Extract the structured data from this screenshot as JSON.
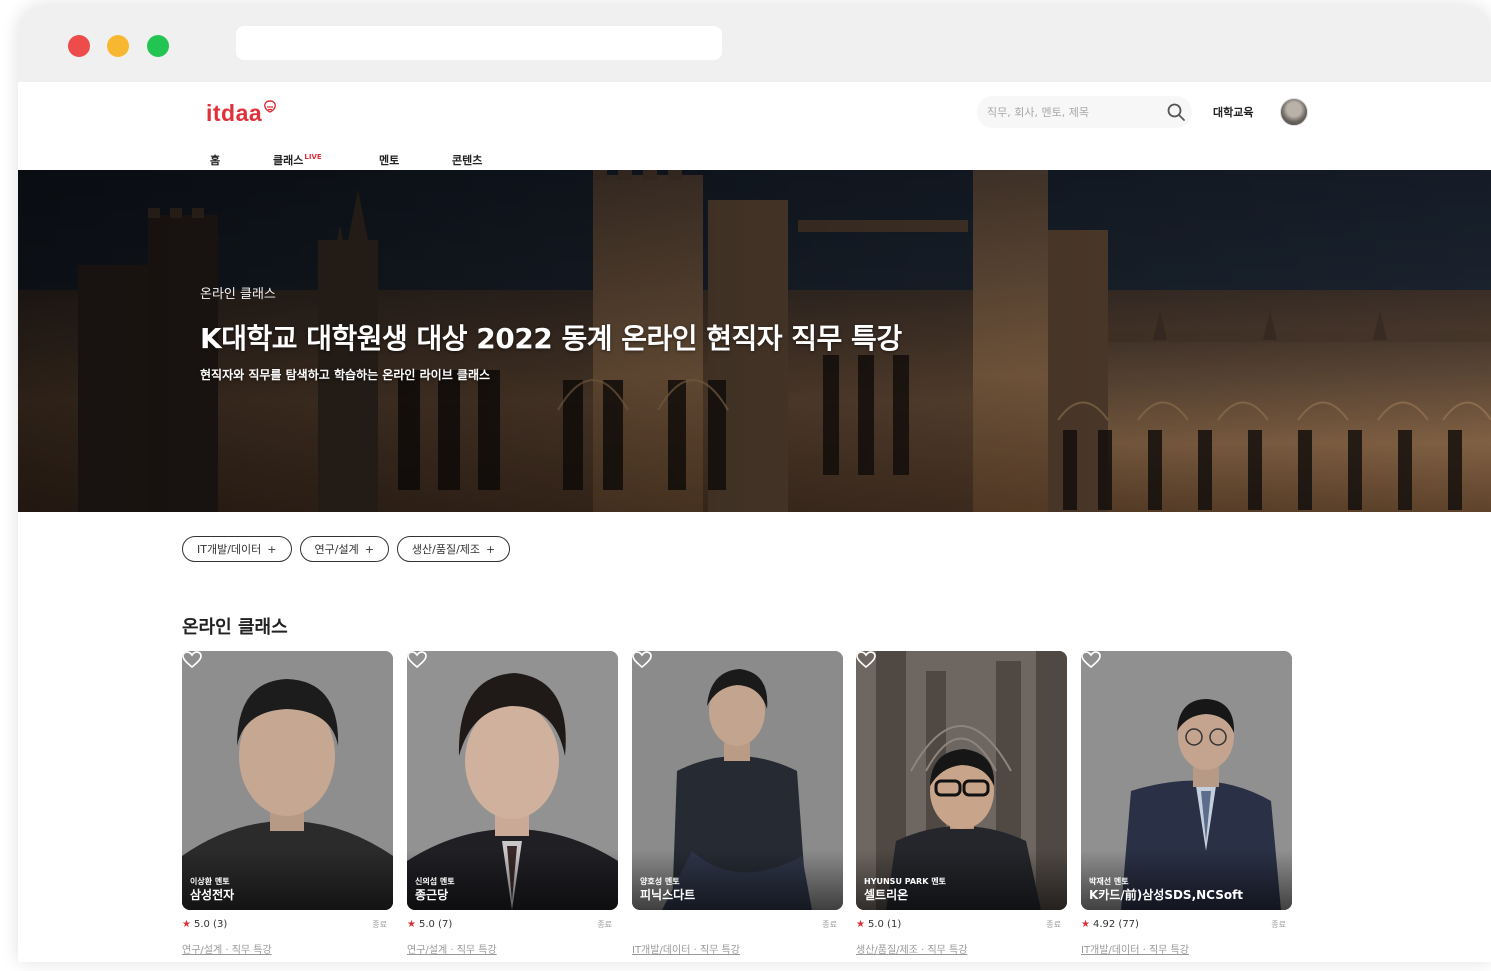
{
  "header": {
    "logo_text": "itdaa",
    "search_placeholder": "직무, 회사, 멘토, 제목",
    "university_link": "대학교육"
  },
  "nav": {
    "items": [
      {
        "label": "홈",
        "badge": ""
      },
      {
        "label": "클래스",
        "badge": "LIVE"
      },
      {
        "label": "멘토",
        "badge": ""
      },
      {
        "label": "콘텐츠",
        "badge": ""
      }
    ]
  },
  "hero": {
    "eyebrow": "온라인 클래스",
    "title": "K대학교 대학원생 대상 2022 동계 온라인 현직자 직무 특강",
    "subtitle": "현직자와 직무를 탐색하고 학습하는 온라인 라이브 클래스"
  },
  "filters": {
    "chips": [
      {
        "label": "IT개발/데이터",
        "icon": "+"
      },
      {
        "label": "연구/설계",
        "icon": "+"
      },
      {
        "label": "생산/품질/제조",
        "icon": "+"
      }
    ]
  },
  "section": {
    "title": "온라인 클래스"
  },
  "cards": [
    {
      "mentor": "이상환 멘토",
      "company": "삼성전자",
      "rating": "5.0 (3)",
      "status": "종료",
      "tags": "연구/설계 · 직무 특강"
    },
    {
      "mentor": "신의섭 멘토",
      "company": "종근당",
      "rating": "5.0 (7)",
      "status": "종료",
      "tags": "연구/설계 · 직무 특강"
    },
    {
      "mentor": "양호성 멘토",
      "company": "피닉스다트",
      "rating": "",
      "status": "종료",
      "tags": "IT개발/데이터 · 직무 특강"
    },
    {
      "mentor": "HYUNSU PARK 멘토",
      "company": "셀트리온",
      "rating": "5.0 (1)",
      "status": "종료",
      "tags": "생산/품질/제조 · 직무 특강"
    },
    {
      "mentor": "박재선 멘토",
      "company": "K카드/前)삼성SDS,NCSoft",
      "rating": "4.92 (77)",
      "status": "종료",
      "tags": "IT개발/데이터 · 직무 특강"
    }
  ],
  "colors": {
    "brand": "#e0303a",
    "mac_red": "#ee4b4b",
    "mac_yellow": "#f7b731",
    "mac_green": "#23c552"
  }
}
